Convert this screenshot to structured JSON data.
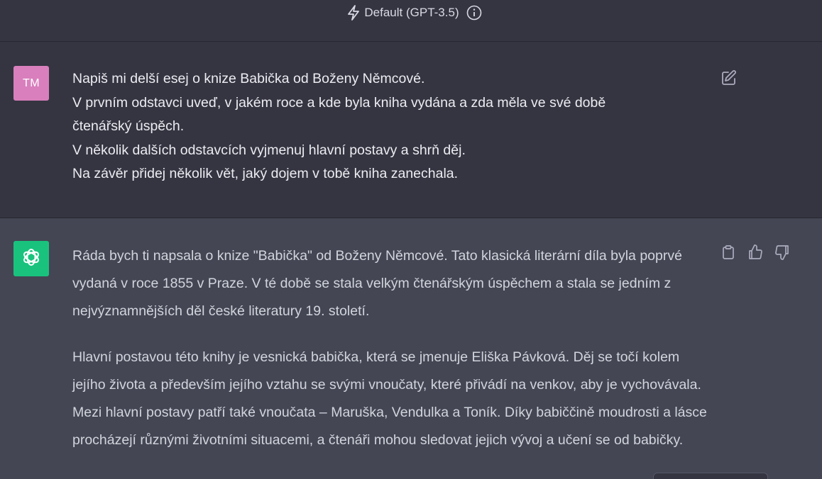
{
  "header": {
    "model_label": "Default (GPT-3.5)",
    "model_icon": "lightning-icon",
    "info_icon": "info-icon"
  },
  "user_message": {
    "avatar_initials": "TM",
    "avatar_color": "#d97fbd",
    "lines": [
      "Napiš mi delší esej o knize Babička od Boženy Němcové.",
      "V prvním odstavci uveď, v jakém roce a kde byla kniha vydána a zda měla ve své době",
      "čtenářský úspěch.",
      "V několik dalších odstavcích vyjmenuj hlavní postavy a shrň děj.",
      "Na závěr přidej několik vět, jaký dojem v tobě kniha zanechala."
    ],
    "edit_icon": "edit-icon"
  },
  "assistant_message": {
    "avatar_color": "#19c37d",
    "paragraphs": [
      "Ráda bych ti napsala o knize \"Babička\" od Boženy Němcové. Tato klasická literární díla byla poprvé vydaná v roce 1855 v Praze. V té době se stala velkým čtenářským úspěchem a stala se jedním z nejvýznamnějších děl české literatury 19. století.",
      "Hlavní postavou této knihy je vesnická babička, která se jmenuje Eliška Pávková. Děj se točí kolem jejího života a především jejího vztahu se svými vnoučaty, které přivádí na venkov, aby je vychovávala. Mezi hlavní postavy patří také vnoučata – Maruška, Vendulka a Toník. Díky babiččině moudrosti a lásce procházejí různými životními situacemi, a čtenáři mohou sledovat jejich vývoj a učení se od babičky."
    ],
    "action_icons": [
      "copy-icon",
      "thumbs-up-icon",
      "thumbs-down-icon"
    ]
  },
  "colors": {
    "background": "#343541",
    "assistant_background": "#444654",
    "text": "#ececf1"
  }
}
